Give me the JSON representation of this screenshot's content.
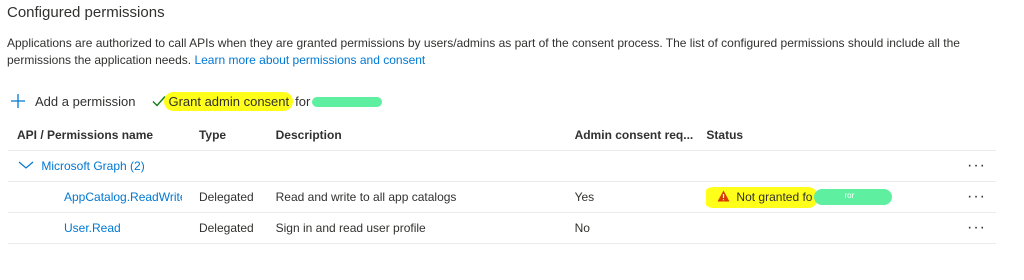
{
  "section": {
    "title": "Configured permissions",
    "description": "Applications are authorized to call APIs when they are granted permissions by users/admins as part of the consent process. The list of configured permissions should include all the permissions the application needs.",
    "learn_more_link": "Learn more about permissions and consent"
  },
  "toolbar": {
    "add_label": "Add a permission",
    "grant_label": "Grant admin consent",
    "grant_suffix": "for"
  },
  "table": {
    "headers": {
      "name": "API / Permissions name",
      "type": "Type",
      "description": "Description",
      "admin": "Admin consent req...",
      "status": "Status"
    },
    "group": {
      "label": "Microsoft Graph (2)"
    },
    "rows": [
      {
        "name": "AppCatalog.ReadWrite.All",
        "type": "Delegated",
        "description": "Read and write to all app catalogs",
        "admin": "Yes",
        "status": "Not granted fo"
      },
      {
        "name": "User.Read",
        "type": "Delegated",
        "description": "Sign in and read user profile",
        "admin": "No",
        "status": ""
      }
    ],
    "more_label": "···",
    "redacted_fragment": "ror"
  },
  "colors": {
    "accent": "#0078d4",
    "warning": "#d83b01",
    "highlight": "#ffff1a",
    "redaction": "#5ef0a0",
    "success": "#107c10"
  },
  "icons": {
    "add": "plus-icon",
    "grant": "checkmark-icon",
    "group": "chevron-down-icon",
    "status": "warning-icon",
    "more": "more-icon"
  }
}
